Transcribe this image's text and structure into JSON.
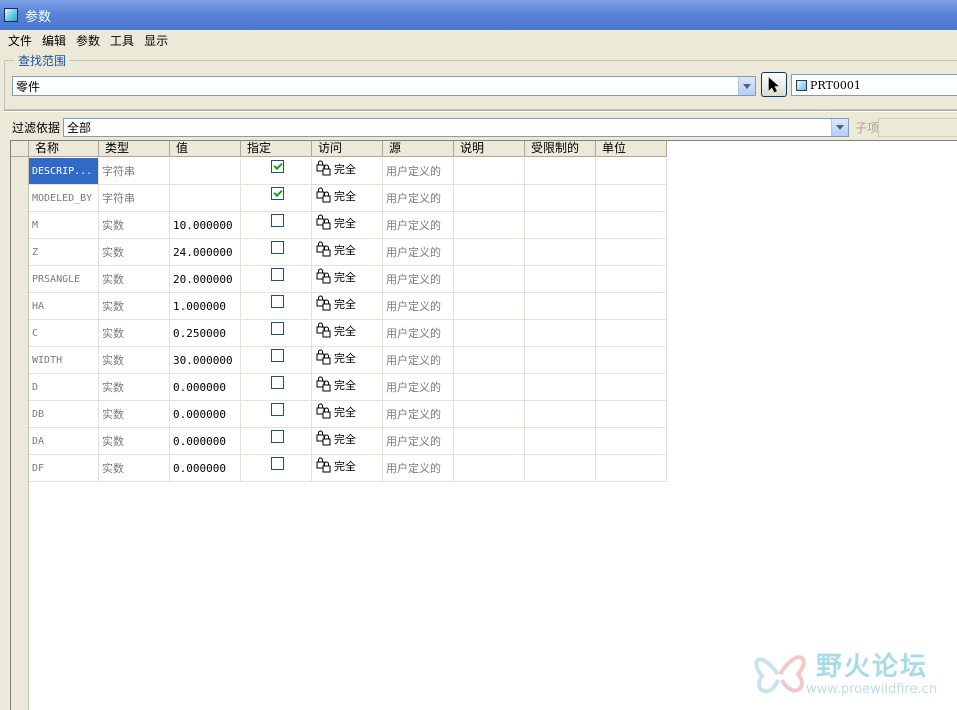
{
  "window": {
    "title": "参数"
  },
  "menu": [
    "文件",
    "编辑",
    "参数",
    "工具",
    "显示"
  ],
  "lookin": {
    "group_label": "查找范围",
    "scope_value": "零件",
    "model_name": "PRT0001"
  },
  "filter": {
    "label": "过滤依据",
    "value": "全部",
    "child_label": "子项"
  },
  "table": {
    "columns": [
      "名称",
      "类型",
      "值",
      "指定",
      "访问",
      "源",
      "说明",
      "受限制的",
      "单位"
    ],
    "rows": [
      {
        "name": "DESCRIP...",
        "type": "字符串",
        "value": "",
        "designate": true,
        "access": "完全",
        "source": "用户定义的",
        "selected": true
      },
      {
        "name": "MODELED_BY",
        "type": "字符串",
        "value": "",
        "designate": true,
        "access": "完全",
        "source": "用户定义的"
      },
      {
        "name": "M",
        "type": "实数",
        "value": "10.000000",
        "designate": false,
        "access": "完全",
        "source": "用户定义的"
      },
      {
        "name": "Z",
        "type": "实数",
        "value": "24.000000",
        "designate": false,
        "access": "完全",
        "source": "用户定义的"
      },
      {
        "name": "PRSANGLE",
        "type": "实数",
        "value": "20.000000",
        "designate": false,
        "access": "完全",
        "source": "用户定义的"
      },
      {
        "name": "HA",
        "type": "实数",
        "value": "1.000000",
        "designate": false,
        "access": "完全",
        "source": "用户定义的"
      },
      {
        "name": "C",
        "type": "实数",
        "value": "0.250000",
        "designate": false,
        "access": "完全",
        "source": "用户定义的"
      },
      {
        "name": "WIDTH",
        "type": "实数",
        "value": "30.000000",
        "designate": false,
        "access": "完全",
        "source": "用户定义的"
      },
      {
        "name": "D",
        "type": "实数",
        "value": "0.000000",
        "designate": false,
        "access": "完全",
        "source": "用户定义的"
      },
      {
        "name": "DB",
        "type": "实数",
        "value": "0.000000",
        "designate": false,
        "access": "完全",
        "source": "用户定义的"
      },
      {
        "name": "DA",
        "type": "实数",
        "value": "0.000000",
        "designate": false,
        "access": "完全",
        "source": "用户定义的"
      },
      {
        "name": "DF",
        "type": "实数",
        "value": "0.000000",
        "designate": false,
        "access": "完全",
        "source": "用户定义的"
      }
    ]
  },
  "watermark": {
    "title": "野火论坛",
    "url": "www.proewildfire.cn"
  },
  "icons": {
    "window": "part-icon",
    "pick": "cursor-arrow-icon",
    "access": "lock-icon"
  },
  "colors": {
    "titlebar": "#5883d8",
    "selection": "#316ac5",
    "check": "#21a121"
  }
}
